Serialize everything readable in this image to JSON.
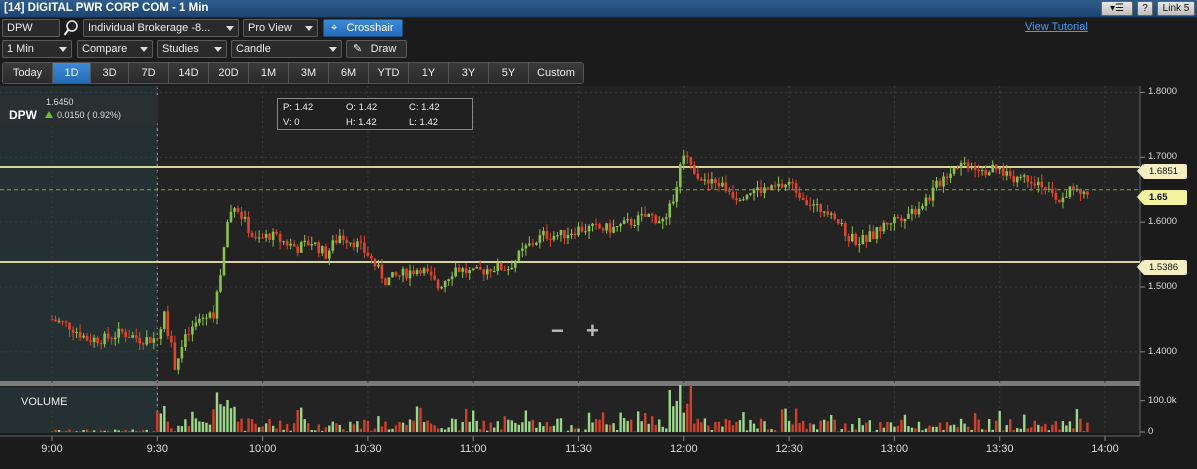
{
  "window": {
    "title": "[14] DIGITAL PWR CORP COM - 1 Min",
    "link_label": "Link 5",
    "help_label": "?",
    "min_label": "_"
  },
  "toolbar": {
    "symbol": "DPW",
    "account": "Individual Brokerage -8...",
    "view": "Pro View",
    "crosshair_label": "Crosshair",
    "view_tutorial": "View Tutorial",
    "interval": "1 Min",
    "compare": "Compare",
    "studies": "Studies",
    "chart_type": "Candle",
    "draw_label": "Draw"
  },
  "ranges": [
    "Today",
    "1D",
    "3D",
    "7D",
    "14D",
    "20D",
    "1M",
    "3M",
    "6M",
    "YTD",
    "1Y",
    "3Y",
    "5Y",
    "Custom"
  ],
  "active_range": "1D",
  "quote": {
    "symbol": "DPW",
    "last": "1.6450",
    "change": "0.0150 ( 0.92%)"
  },
  "crosshair": {
    "p": "P: 1.42",
    "o": "O: 1.42",
    "c": "C: 1.42",
    "v": "V: 0",
    "h": "H: 1.42",
    "l": "L: 1.42"
  },
  "volume_label": "VOLUME",
  "zoom": {
    "minus": "−",
    "plus": "+"
  },
  "price_tags": {
    "upper": "1.6851",
    "last": "1.65",
    "lower": "1.5386"
  },
  "colors": {
    "up": "#8bc34a",
    "down": "#e0452b",
    "hline": "#d8d29a",
    "accent": "#3d8ad8"
  },
  "chart_data": {
    "type": "candlestick",
    "symbol": "DPW",
    "interval": "1 Min",
    "y_ticks": [
      "1.8000",
      "1.7000",
      "1.6000",
      "1.5000",
      "1.4000"
    ],
    "ylim": [
      1.355,
      1.81
    ],
    "volume_ticks": [
      "100.0k",
      "0"
    ],
    "volume_max": 150000,
    "x_ticks": [
      "9:00",
      "9:30",
      "10:00",
      "10:30",
      "11:00",
      "11:30",
      "12:00",
      "12:30",
      "13:00",
      "13:30",
      "14:00"
    ],
    "x_minutes": [
      0,
      30,
      60,
      90,
      120,
      150,
      180,
      210,
      240,
      270,
      300
    ],
    "session_open_minute": 30,
    "horizontal_lines": [
      1.6851,
      1.5386
    ],
    "last_price_line": 1.65,
    "price_path": [
      [
        0,
        1.45
      ],
      [
        5,
        1.44
      ],
      [
        10,
        1.42
      ],
      [
        15,
        1.42
      ],
      [
        20,
        1.43
      ],
      [
        25,
        1.42
      ],
      [
        30,
        1.42
      ],
      [
        32,
        1.46
      ],
      [
        35,
        1.38
      ],
      [
        38,
        1.42
      ],
      [
        42,
        1.45
      ],
      [
        46,
        1.46
      ],
      [
        48,
        1.52
      ],
      [
        50,
        1.6
      ],
      [
        52,
        1.63
      ],
      [
        55,
        1.6
      ],
      [
        58,
        1.57
      ],
      [
        62,
        1.58
      ],
      [
        66,
        1.57
      ],
      [
        70,
        1.56
      ],
      [
        74,
        1.57
      ],
      [
        78,
        1.55
      ],
      [
        82,
        1.58
      ],
      [
        86,
        1.57
      ],
      [
        90,
        1.55
      ],
      [
        95,
        1.51
      ],
      [
        100,
        1.52
      ],
      [
        105,
        1.53
      ],
      [
        110,
        1.5
      ],
      [
        115,
        1.53
      ],
      [
        120,
        1.52
      ],
      [
        125,
        1.53
      ],
      [
        130,
        1.53
      ],
      [
        135,
        1.56
      ],
      [
        140,
        1.58
      ],
      [
        145,
        1.58
      ],
      [
        150,
        1.59
      ],
      [
        155,
        1.59
      ],
      [
        160,
        1.59
      ],
      [
        165,
        1.6
      ],
      [
        170,
        1.61
      ],
      [
        175,
        1.6
      ],
      [
        178,
        1.66
      ],
      [
        180,
        1.71
      ],
      [
        182,
        1.69
      ],
      [
        186,
        1.66
      ],
      [
        190,
        1.66
      ],
      [
        195,
        1.64
      ],
      [
        200,
        1.65
      ],
      [
        205,
        1.65
      ],
      [
        210,
        1.66
      ],
      [
        214,
        1.64
      ],
      [
        218,
        1.62
      ],
      [
        222,
        1.62
      ],
      [
        226,
        1.58
      ],
      [
        230,
        1.57
      ],
      [
        234,
        1.58
      ],
      [
        238,
        1.6
      ],
      [
        242,
        1.61
      ],
      [
        246,
        1.62
      ],
      [
        250,
        1.64
      ],
      [
        254,
        1.67
      ],
      [
        258,
        1.69
      ],
      [
        262,
        1.69
      ],
      [
        266,
        1.68
      ],
      [
        270,
        1.68
      ],
      [
        274,
        1.67
      ],
      [
        278,
        1.67
      ],
      [
        282,
        1.66
      ],
      [
        286,
        1.63
      ],
      [
        290,
        1.65
      ],
      [
        295,
        1.64
      ]
    ]
  }
}
